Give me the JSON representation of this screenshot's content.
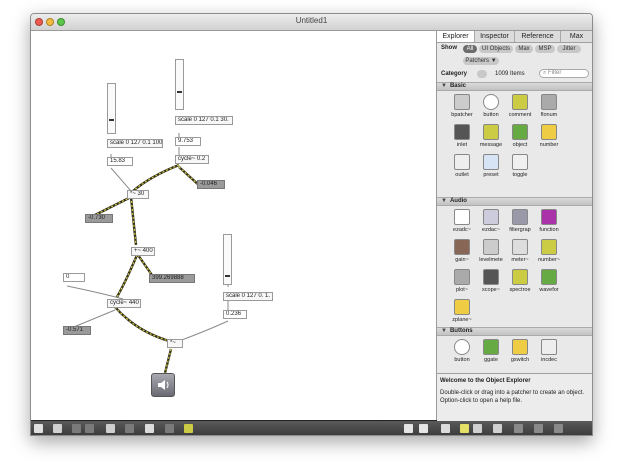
{
  "window": {
    "title": "Untitled1"
  },
  "patcher": {
    "objects": {
      "scale1": "scale 0 127 0.1 100.",
      "scale2": "scale 0 127 0.1 30.",
      "scale3": "scale 0 127 0. 1.",
      "cycle1": "cycle~ 0.2",
      "cycle2": "cycle~ 440",
      "mul30": "*~ 30",
      "add400": "+~ 400",
      "mul_final": "*~"
    },
    "numbers": {
      "n1": "15.83",
      "n2": "9.753",
      "n3": "-0.046",
      "n4": "-0.730",
      "n5": "399.269888",
      "n6": "0",
      "n7": "-0.571",
      "n8": "0.236"
    },
    "sliders": {
      "s1_level": 0.55,
      "s2_level": 0.6,
      "s3_level": 0.45
    }
  },
  "sidebar": {
    "tabs": [
      "Explorer",
      "Inspector",
      "Reference",
      "Max"
    ],
    "show_label": "Show",
    "filters": [
      "All",
      "UI Objects",
      "Max",
      "MSP",
      "Jitter",
      "Patchers ▼"
    ],
    "category_label": "Category",
    "items_count": "1009 Items",
    "filter_placeholder": "Filter",
    "sections": {
      "basic": "Basic",
      "audio": "Audio",
      "buttons": "Buttons"
    },
    "basic_items": [
      "bpatcher",
      "button",
      "comment",
      "flonum",
      "inlet",
      "message",
      "object",
      "number",
      "outlet",
      "preset",
      "toggle"
    ],
    "audio_items": [
      "ezadc~",
      "ezdac~",
      "filtergrap",
      "function",
      "gain~",
      "levelmete",
      "meter~",
      "number~",
      "plot~",
      "scope~",
      "spectroe",
      "wavefor",
      "zplane~"
    ],
    "button_items": [
      "button",
      "ggate",
      "gswitch",
      "incdec"
    ],
    "info": {
      "heading": "Welcome to the Object Explorer",
      "body": "Double-click or drag into a patcher to create an object. Option-click to open a help file."
    }
  }
}
